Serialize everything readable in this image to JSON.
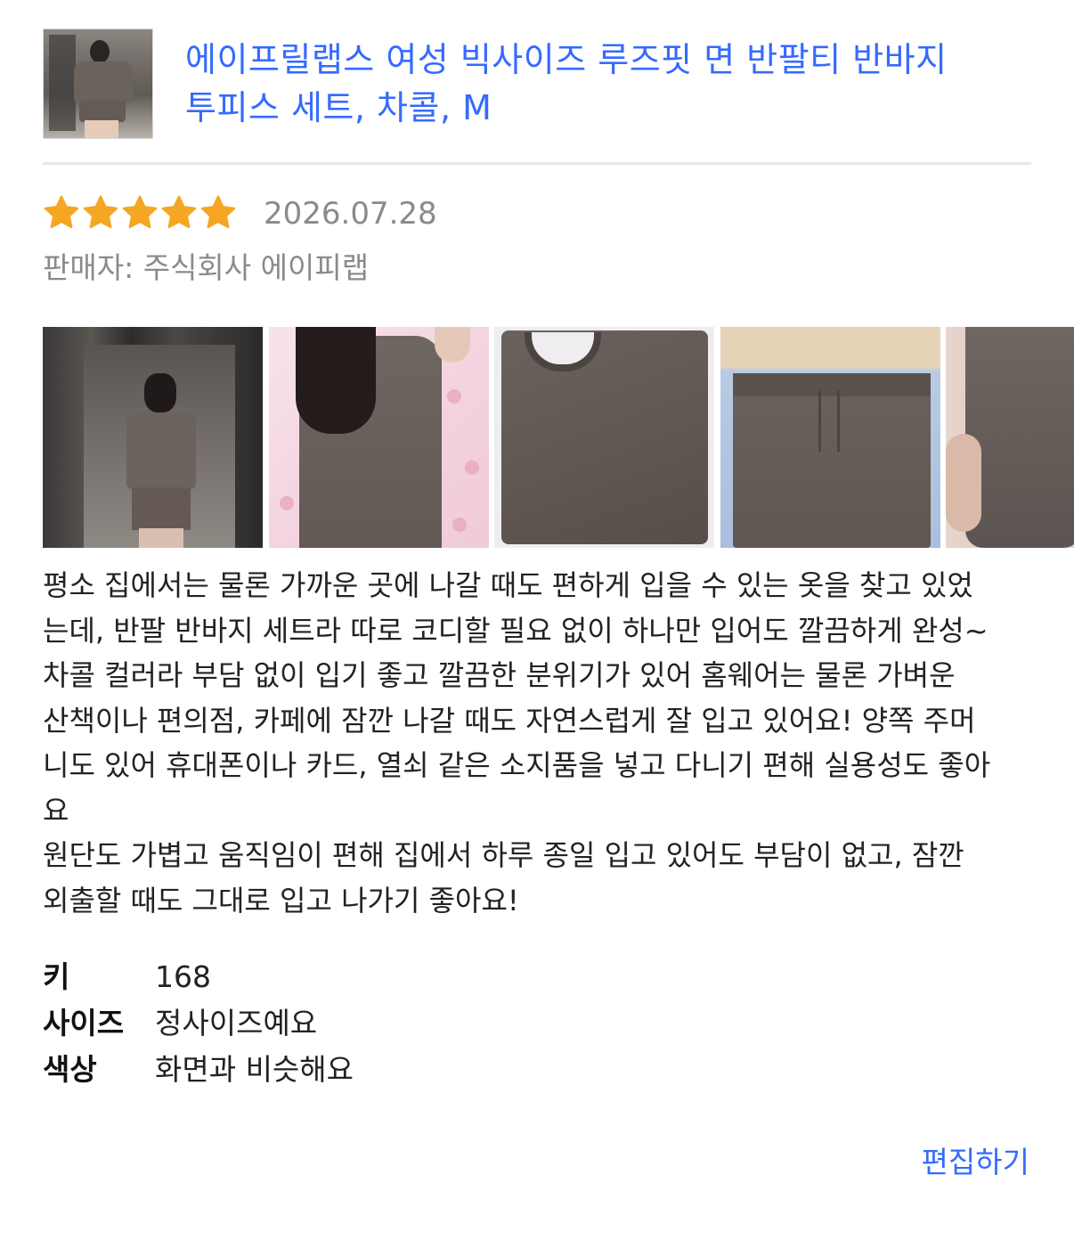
{
  "product": {
    "title_lines": [
      "에이프릴랩스 여성 빅사이즈 루즈핏 면 반팔티 반바지",
      "투피스 세트, 차콜, M"
    ]
  },
  "review": {
    "rating": 5,
    "max_rating": 5,
    "star_color": "#f5a623",
    "date": "2026.07.28",
    "seller_label": "판매자:",
    "seller_name": "주식회사 에이피랩",
    "body_lines": [
      "평소 집에서는 물론 가까운 곳에 나갈 때도 편하게 입을 수 있는 옷을 찾고 있었",
      "는데, 반팔 반바지 세트라 따로 코디할 필요 없이 하나만 입어도 깔끔하게 완성~",
      "차콜 컬러라 부담 없이 입기 좋고 깔끔한 분위기가 있어 홈웨어는 물론 가벼운",
      "산책이나 편의점, 카페에 잠깐 나갈 때도 자연스럽게 잘 입고 있어요! 양쪽 주머",
      "니도 있어 휴대폰이나 카드, 열쇠 같은 소지품을 넣고 다니기 편해 실용성도 좋아",
      "요",
      "원단도 가볍고 움직임이 편해 집에서 하루 종일 입고 있어도 부담이 없고, 잠깐",
      "외출할 때도 그대로 입고 나가기 좋아요!"
    ],
    "specs": [
      {
        "key": "키",
        "value": "168"
      },
      {
        "key": "사이즈",
        "value": "정사이즈예요"
      },
      {
        "key": "색상",
        "value": "화면과 비슷해요"
      }
    ]
  },
  "actions": {
    "edit_label": "편집하기"
  },
  "colors": {
    "link_blue": "#346aff",
    "meta_gray": "#8a8a8a",
    "divider": "#e8e8e8"
  }
}
